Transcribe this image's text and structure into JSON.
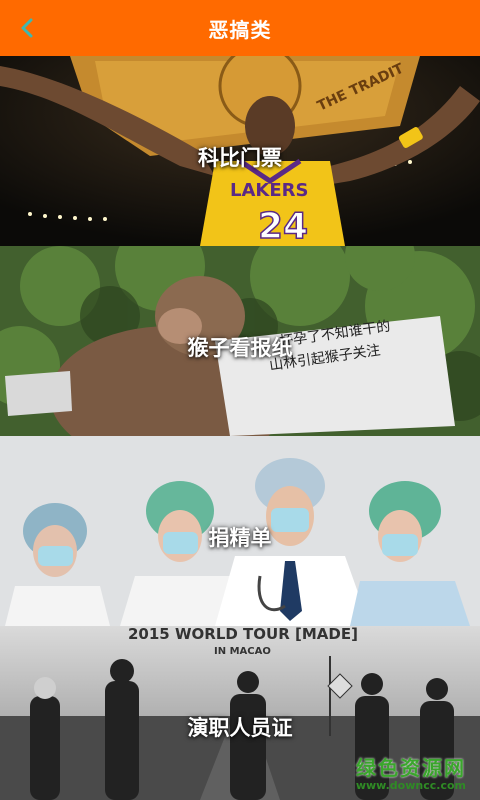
{
  "header": {
    "title": "恶搞类",
    "back_icon": "back-chevron-icon",
    "bar_color": "#ff6a00",
    "back_color": "#3fb8b0"
  },
  "cards": [
    {
      "label": "科比门票",
      "banner_text": [
        "THE TRADIT"
      ],
      "jersey_text": [
        "LAKERS",
        "24"
      ]
    },
    {
      "label": "猴子看报纸",
      "newspaper_text": [
        "杯孕了不知谁干的",
        "山林引起猴子关注"
      ]
    },
    {
      "label": "捐精单"
    },
    {
      "label": "演职人员证",
      "poster_title": "2015 WORLD TOUR [MADE]",
      "poster_sub": "IN MACAO"
    }
  ],
  "watermark": {
    "line1": "绿色资源网",
    "line2": "www.downcc.com"
  }
}
